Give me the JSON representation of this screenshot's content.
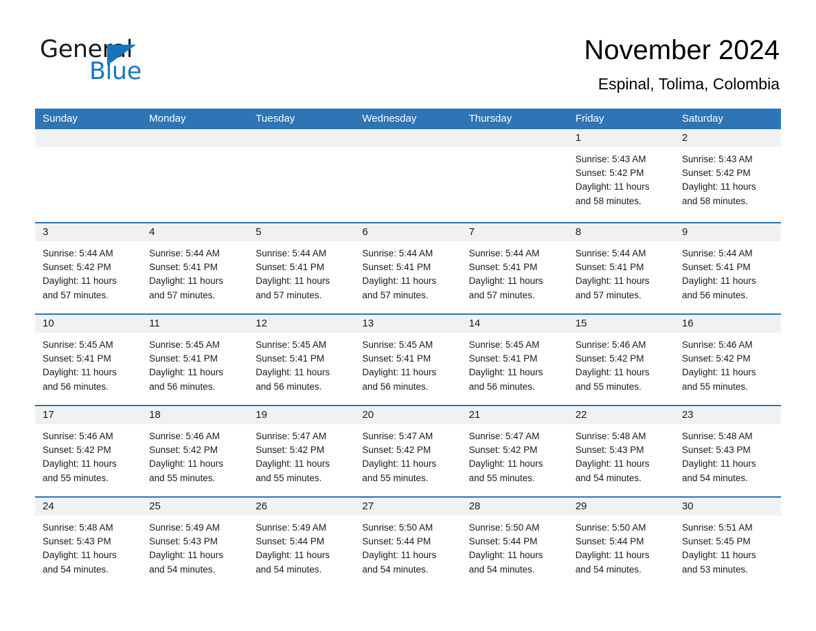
{
  "brand": {
    "name_part1": "General",
    "name_part2": "Blue",
    "accent_color": "#1474bd"
  },
  "header": {
    "title": "November 2024",
    "subtitle": "Espinal, Tolima, Colombia"
  },
  "calendar": {
    "header_bg": "#2e75b6",
    "day_band_bg": "#f1f1f1",
    "weekdays": [
      "Sunday",
      "Monday",
      "Tuesday",
      "Wednesday",
      "Thursday",
      "Friday",
      "Saturday"
    ],
    "weeks": [
      [
        {
          "day": "",
          "sunrise": "",
          "sunset": "",
          "daylight_line1": "",
          "daylight_line2": ""
        },
        {
          "day": "",
          "sunrise": "",
          "sunset": "",
          "daylight_line1": "",
          "daylight_line2": ""
        },
        {
          "day": "",
          "sunrise": "",
          "sunset": "",
          "daylight_line1": "",
          "daylight_line2": ""
        },
        {
          "day": "",
          "sunrise": "",
          "sunset": "",
          "daylight_line1": "",
          "daylight_line2": ""
        },
        {
          "day": "",
          "sunrise": "",
          "sunset": "",
          "daylight_line1": "",
          "daylight_line2": ""
        },
        {
          "day": "1",
          "sunrise": "Sunrise: 5:43 AM",
          "sunset": "Sunset: 5:42 PM",
          "daylight_line1": "Daylight: 11 hours",
          "daylight_line2": "and 58 minutes."
        },
        {
          "day": "2",
          "sunrise": "Sunrise: 5:43 AM",
          "sunset": "Sunset: 5:42 PM",
          "daylight_line1": "Daylight: 11 hours",
          "daylight_line2": "and 58 minutes."
        }
      ],
      [
        {
          "day": "3",
          "sunrise": "Sunrise: 5:44 AM",
          "sunset": "Sunset: 5:42 PM",
          "daylight_line1": "Daylight: 11 hours",
          "daylight_line2": "and 57 minutes."
        },
        {
          "day": "4",
          "sunrise": "Sunrise: 5:44 AM",
          "sunset": "Sunset: 5:41 PM",
          "daylight_line1": "Daylight: 11 hours",
          "daylight_line2": "and 57 minutes."
        },
        {
          "day": "5",
          "sunrise": "Sunrise: 5:44 AM",
          "sunset": "Sunset: 5:41 PM",
          "daylight_line1": "Daylight: 11 hours",
          "daylight_line2": "and 57 minutes."
        },
        {
          "day": "6",
          "sunrise": "Sunrise: 5:44 AM",
          "sunset": "Sunset: 5:41 PM",
          "daylight_line1": "Daylight: 11 hours",
          "daylight_line2": "and 57 minutes."
        },
        {
          "day": "7",
          "sunrise": "Sunrise: 5:44 AM",
          "sunset": "Sunset: 5:41 PM",
          "daylight_line1": "Daylight: 11 hours",
          "daylight_line2": "and 57 minutes."
        },
        {
          "day": "8",
          "sunrise": "Sunrise: 5:44 AM",
          "sunset": "Sunset: 5:41 PM",
          "daylight_line1": "Daylight: 11 hours",
          "daylight_line2": "and 57 minutes."
        },
        {
          "day": "9",
          "sunrise": "Sunrise: 5:44 AM",
          "sunset": "Sunset: 5:41 PM",
          "daylight_line1": "Daylight: 11 hours",
          "daylight_line2": "and 56 minutes."
        }
      ],
      [
        {
          "day": "10",
          "sunrise": "Sunrise: 5:45 AM",
          "sunset": "Sunset: 5:41 PM",
          "daylight_line1": "Daylight: 11 hours",
          "daylight_line2": "and 56 minutes."
        },
        {
          "day": "11",
          "sunrise": "Sunrise: 5:45 AM",
          "sunset": "Sunset: 5:41 PM",
          "daylight_line1": "Daylight: 11 hours",
          "daylight_line2": "and 56 minutes."
        },
        {
          "day": "12",
          "sunrise": "Sunrise: 5:45 AM",
          "sunset": "Sunset: 5:41 PM",
          "daylight_line1": "Daylight: 11 hours",
          "daylight_line2": "and 56 minutes."
        },
        {
          "day": "13",
          "sunrise": "Sunrise: 5:45 AM",
          "sunset": "Sunset: 5:41 PM",
          "daylight_line1": "Daylight: 11 hours",
          "daylight_line2": "and 56 minutes."
        },
        {
          "day": "14",
          "sunrise": "Sunrise: 5:45 AM",
          "sunset": "Sunset: 5:41 PM",
          "daylight_line1": "Daylight: 11 hours",
          "daylight_line2": "and 56 minutes."
        },
        {
          "day": "15",
          "sunrise": "Sunrise: 5:46 AM",
          "sunset": "Sunset: 5:42 PM",
          "daylight_line1": "Daylight: 11 hours",
          "daylight_line2": "and 55 minutes."
        },
        {
          "day": "16",
          "sunrise": "Sunrise: 5:46 AM",
          "sunset": "Sunset: 5:42 PM",
          "daylight_line1": "Daylight: 11 hours",
          "daylight_line2": "and 55 minutes."
        }
      ],
      [
        {
          "day": "17",
          "sunrise": "Sunrise: 5:46 AM",
          "sunset": "Sunset: 5:42 PM",
          "daylight_line1": "Daylight: 11 hours",
          "daylight_line2": "and 55 minutes."
        },
        {
          "day": "18",
          "sunrise": "Sunrise: 5:46 AM",
          "sunset": "Sunset: 5:42 PM",
          "daylight_line1": "Daylight: 11 hours",
          "daylight_line2": "and 55 minutes."
        },
        {
          "day": "19",
          "sunrise": "Sunrise: 5:47 AM",
          "sunset": "Sunset: 5:42 PM",
          "daylight_line1": "Daylight: 11 hours",
          "daylight_line2": "and 55 minutes."
        },
        {
          "day": "20",
          "sunrise": "Sunrise: 5:47 AM",
          "sunset": "Sunset: 5:42 PM",
          "daylight_line1": "Daylight: 11 hours",
          "daylight_line2": "and 55 minutes."
        },
        {
          "day": "21",
          "sunrise": "Sunrise: 5:47 AM",
          "sunset": "Sunset: 5:42 PM",
          "daylight_line1": "Daylight: 11 hours",
          "daylight_line2": "and 55 minutes."
        },
        {
          "day": "22",
          "sunrise": "Sunrise: 5:48 AM",
          "sunset": "Sunset: 5:43 PM",
          "daylight_line1": "Daylight: 11 hours",
          "daylight_line2": "and 54 minutes."
        },
        {
          "day": "23",
          "sunrise": "Sunrise: 5:48 AM",
          "sunset": "Sunset: 5:43 PM",
          "daylight_line1": "Daylight: 11 hours",
          "daylight_line2": "and 54 minutes."
        }
      ],
      [
        {
          "day": "24",
          "sunrise": "Sunrise: 5:48 AM",
          "sunset": "Sunset: 5:43 PM",
          "daylight_line1": "Daylight: 11 hours",
          "daylight_line2": "and 54 minutes."
        },
        {
          "day": "25",
          "sunrise": "Sunrise: 5:49 AM",
          "sunset": "Sunset: 5:43 PM",
          "daylight_line1": "Daylight: 11 hours",
          "daylight_line2": "and 54 minutes."
        },
        {
          "day": "26",
          "sunrise": "Sunrise: 5:49 AM",
          "sunset": "Sunset: 5:44 PM",
          "daylight_line1": "Daylight: 11 hours",
          "daylight_line2": "and 54 minutes."
        },
        {
          "day": "27",
          "sunrise": "Sunrise: 5:50 AM",
          "sunset": "Sunset: 5:44 PM",
          "daylight_line1": "Daylight: 11 hours",
          "daylight_line2": "and 54 minutes."
        },
        {
          "day": "28",
          "sunrise": "Sunrise: 5:50 AM",
          "sunset": "Sunset: 5:44 PM",
          "daylight_line1": "Daylight: 11 hours",
          "daylight_line2": "and 54 minutes."
        },
        {
          "day": "29",
          "sunrise": "Sunrise: 5:50 AM",
          "sunset": "Sunset: 5:44 PM",
          "daylight_line1": "Daylight: 11 hours",
          "daylight_line2": "and 54 minutes."
        },
        {
          "day": "30",
          "sunrise": "Sunrise: 5:51 AM",
          "sunset": "Sunset: 5:45 PM",
          "daylight_line1": "Daylight: 11 hours",
          "daylight_line2": "and 53 minutes."
        }
      ]
    ]
  }
}
